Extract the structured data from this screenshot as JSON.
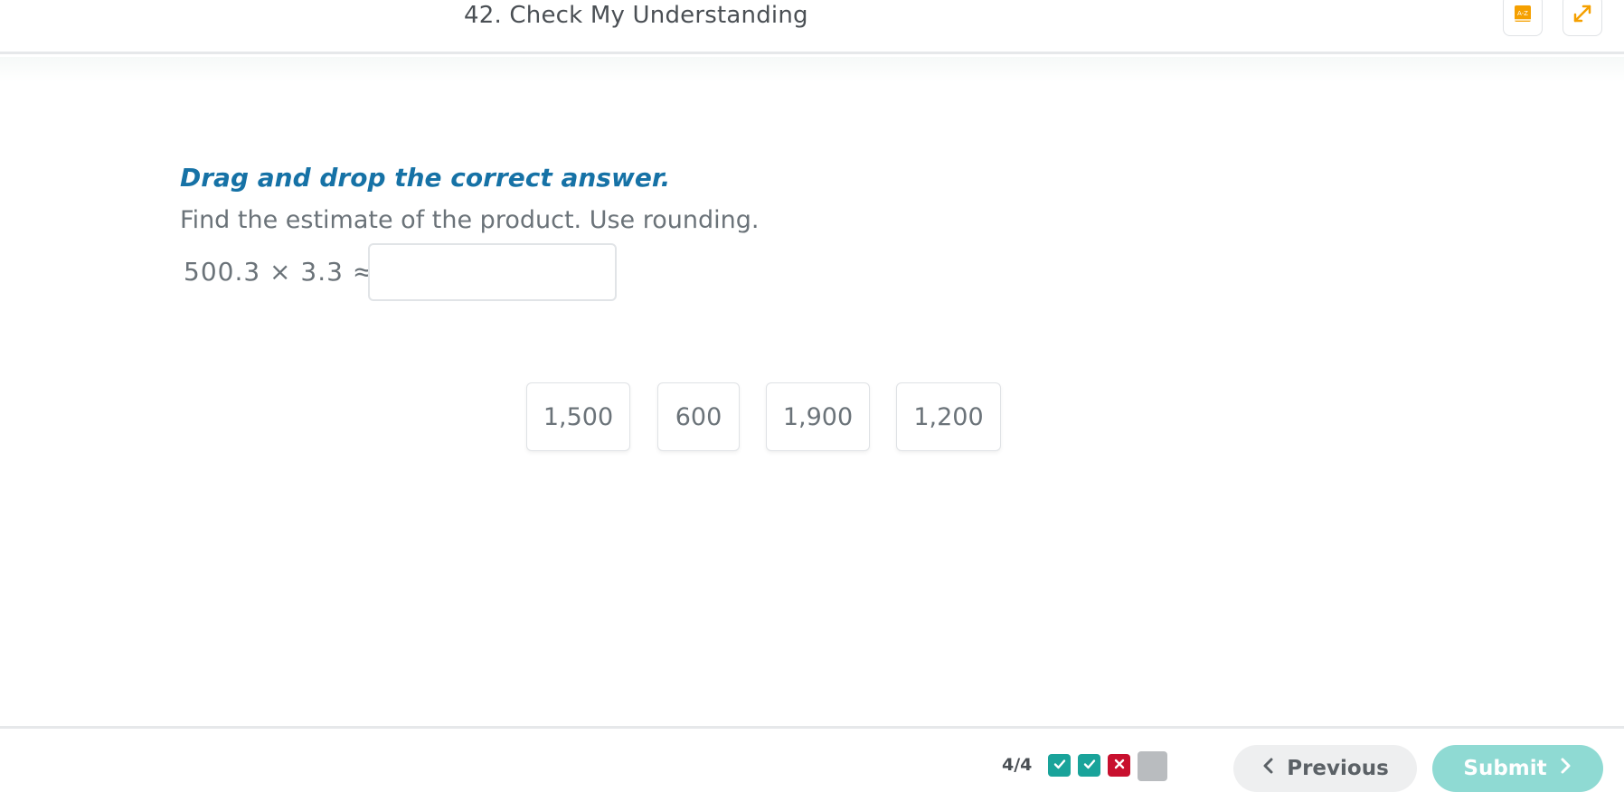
{
  "header": {
    "title": "42. Check My Understanding",
    "glossary_icon": "glossary-book-icon",
    "expand_icon": "expand-arrows-icon",
    "accent": "#f5a000"
  },
  "question": {
    "instruction": "Drag and drop the correct answer.",
    "prompt": "Find the estimate of the product. Use rounding.",
    "expression": "500.3 × 3.3 ≈"
  },
  "answers": [
    "1,500",
    "600",
    "1,900",
    "1,200"
  ],
  "footer": {
    "counter": "4/4",
    "statuses": [
      "correct",
      "correct",
      "wrong",
      "pending"
    ],
    "previous_label": "Previous",
    "submit_label": "Submit"
  },
  "colors": {
    "instruction": "#1672a6",
    "correct": "#19a39a",
    "wrong": "#c8102e",
    "submit": "#8fdad3"
  }
}
